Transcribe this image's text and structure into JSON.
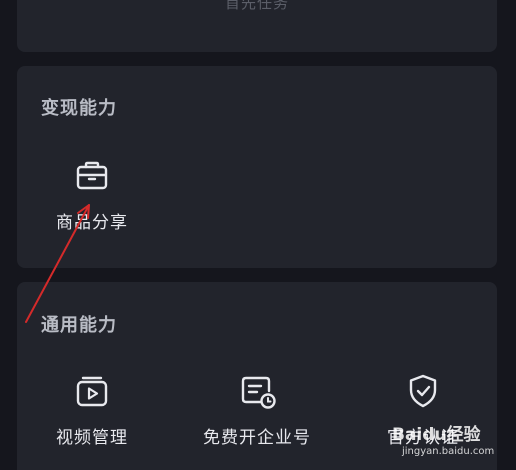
{
  "top_card": {
    "faded_text": "首先任务"
  },
  "monetize": {
    "title": "变现能力",
    "items": [
      {
        "label": "商品分享",
        "icon": "briefcase-icon"
      }
    ]
  },
  "general": {
    "title": "通用能力",
    "items": [
      {
        "label": "视频管理",
        "icon": "video-play-icon"
      },
      {
        "label": "免费开企业号",
        "icon": "enterprise-card-clock-icon"
      },
      {
        "label": "官方认证",
        "icon": "shield-check-icon"
      }
    ]
  },
  "annotation": {
    "arrow_color": "#d42a2a"
  },
  "watermark": {
    "brand": "Baidu经验",
    "site": "jingyan.baidu.com"
  }
}
